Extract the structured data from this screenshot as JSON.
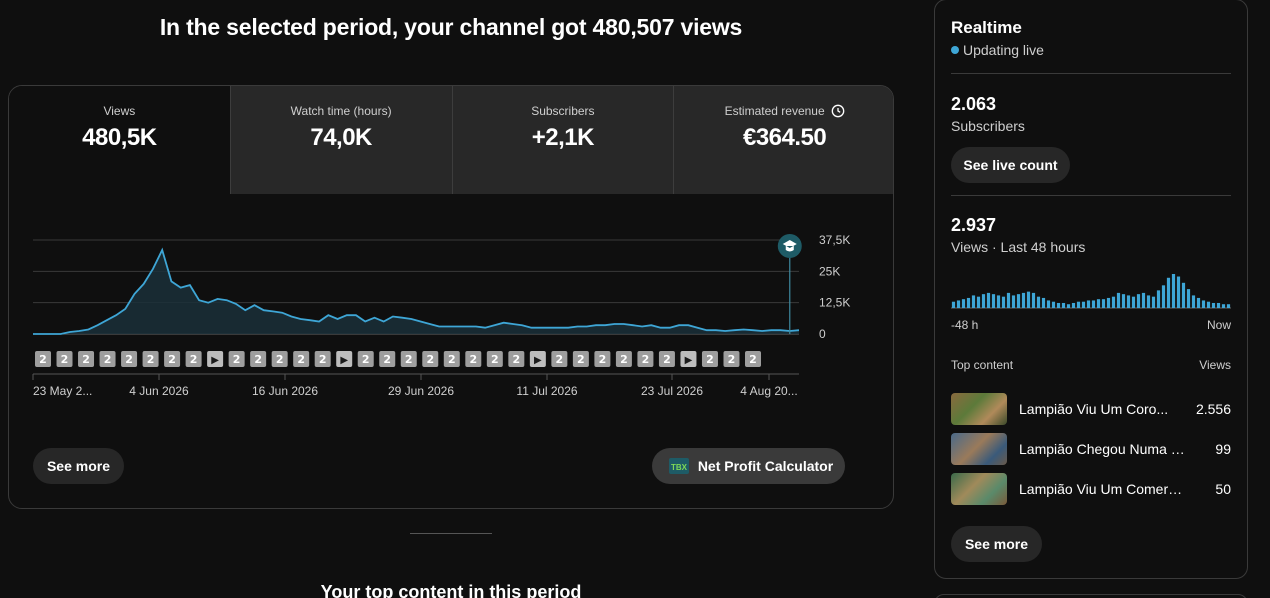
{
  "headline": "In the selected period, your channel got 480,507 views",
  "tabs": [
    {
      "label": "Views",
      "value": "480,5K"
    },
    {
      "label": "Watch time (hours)",
      "value": "74,0K"
    },
    {
      "label": "Subscribers",
      "value": "+2,1K"
    },
    {
      "label": "Estimated revenue",
      "value": "€364.50"
    }
  ],
  "chart_data": {
    "type": "area",
    "title": "",
    "xlabel": "",
    "ylabel": "",
    "y_ticks": [
      "37,5K",
      "25K",
      "12,5K",
      "0"
    ],
    "ylim": [
      0,
      37500
    ],
    "x_ticks": [
      "23 May 2...",
      "4 Jun 2026",
      "16 Jun 2026",
      "29 Jun 2026",
      "11 Jul 2026",
      "23 Jul 2026",
      "4 Aug 20..."
    ],
    "grid": true,
    "color": "#3ea6d6",
    "series": [
      {
        "name": "",
        "values": [
          0,
          0,
          0,
          0,
          800,
          1200,
          1800,
          3500,
          5500,
          7500,
          10000,
          16000,
          20000,
          26000,
          33500,
          21000,
          18500,
          19500,
          13500,
          12500,
          14000,
          13500,
          12000,
          9500,
          11500,
          9500,
          9000,
          8500,
          7000,
          6000,
          5500,
          5000,
          7500,
          6000,
          7500,
          7500,
          5000,
          6500,
          5000,
          7000,
          6500,
          6000,
          5000,
          4000,
          3000,
          3000,
          3000,
          3000,
          3000,
          2500,
          3500,
          4500,
          4000,
          3500,
          2500,
          2500,
          2500,
          2500,
          2500,
          3000,
          3000,
          3500,
          3500,
          4000,
          4000,
          3500,
          3000,
          3500,
          2500,
          2500,
          3500,
          3500,
          2500,
          1500,
          1500,
          1200,
          1500,
          1800,
          1500,
          1200,
          1500,
          1500,
          1200,
          1500
        ]
      }
    ],
    "marker_labels": [
      "2",
      "2",
      "2",
      "2",
      "2",
      "2",
      "2",
      "2",
      "▶",
      "2",
      "2",
      "2",
      "2",
      "2",
      "▶",
      "2",
      "2",
      "2",
      "2",
      "2",
      "2",
      "2",
      "2",
      "▶",
      "2",
      "2",
      "2",
      "2",
      "2",
      "2",
      "▶",
      "2",
      "2",
      "2"
    ],
    "highlight_index": 82
  },
  "see_more": "See more",
  "npc": {
    "label": "Net Profit Calculator",
    "logo": "TBX"
  },
  "top_content_title": "Your top content in this period",
  "realtime": {
    "title": "Realtime",
    "live": "Updating live",
    "subs_value": "2.063",
    "subs_label": "Subscribers",
    "live_btn": "See live count",
    "views_value": "2.937",
    "views_label": "Views · Last 48 hours",
    "axis_left": "-48 h",
    "axis_right": "Now",
    "mini_bars": [
      5,
      6,
      7,
      8,
      10,
      9,
      11,
      12,
      11,
      10,
      9,
      12,
      10,
      11,
      12,
      13,
      12,
      9,
      8,
      6,
      5,
      4,
      4,
      3,
      4,
      5,
      5,
      6,
      6,
      7,
      7,
      8,
      9,
      12,
      11,
      10,
      9,
      11,
      12,
      10,
      9,
      14,
      18,
      24,
      27,
      25,
      20,
      15,
      10,
      8,
      6,
      5,
      4,
      4,
      3,
      3
    ],
    "top_header": "Top content",
    "top_views_header": "Views",
    "items": [
      {
        "title": "Lampião Viu Um Coro...",
        "views": "2.556"
      },
      {
        "title": "Lampião Chegou Numa F...",
        "views": "99"
      },
      {
        "title": "Lampião Viu Um Comerci...",
        "views": "50"
      }
    ],
    "see_more": "See more"
  }
}
